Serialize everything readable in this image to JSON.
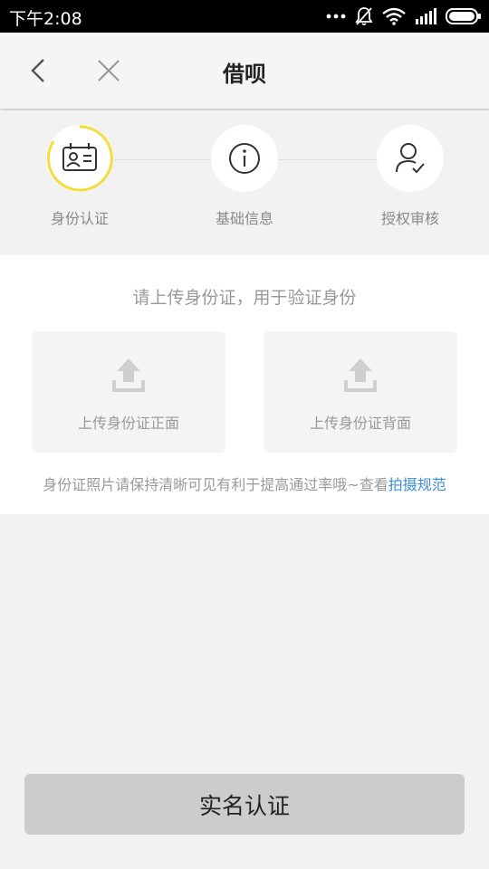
{
  "status_bar": {
    "time": "下午2:08",
    "icons": [
      "more-dots-icon",
      "bell-muted-icon",
      "wifi-icon",
      "signal-icon",
      "battery-icon"
    ]
  },
  "nav": {
    "title": "借呗",
    "back_icon": "back-arrow-icon",
    "close_icon": "close-icon"
  },
  "steps": [
    {
      "label": "身份认证",
      "icon": "id-card-icon",
      "active": true
    },
    {
      "label": "基础信息",
      "icon": "info-icon",
      "active": false
    },
    {
      "label": "授权审核",
      "icon": "user-check-icon",
      "active": false
    }
  ],
  "upload": {
    "prompt": "请上传身份证，用于验证身份",
    "front_label": "上传身份证正面",
    "back_label": "上传身份证背面",
    "tip_text": "身份证照片请保持清晰可见有利于提高通过率哦~查看",
    "tip_link": "拍摄规范"
  },
  "submit_label": "实名认证",
  "colors": {
    "accent_yellow": "#f4dc3c",
    "link_blue": "#3a8fd8",
    "button_gray": "#cccccc"
  }
}
